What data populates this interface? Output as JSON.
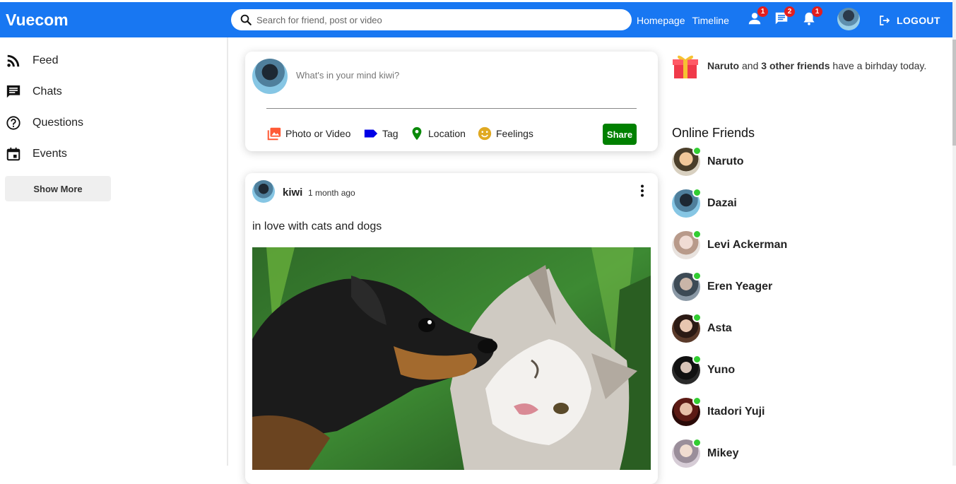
{
  "app": {
    "title": "Vuecom"
  },
  "header": {
    "search_placeholder": "Search for friend, post or video",
    "links": [
      "Homepage",
      "Timeline"
    ],
    "friend_requests_count": "1",
    "messages_count": "2",
    "notifications_count": "1",
    "logout_label": "LOGOUT"
  },
  "sidebar": {
    "items": [
      {
        "label": "Feed",
        "icon": "rss-icon"
      },
      {
        "label": "Chats",
        "icon": "chat-icon"
      },
      {
        "label": "Questions",
        "icon": "question-icon"
      },
      {
        "label": "Events",
        "icon": "calendar-icon"
      }
    ],
    "show_more": "Show More"
  },
  "share": {
    "placeholder": "What's in your mind kiwi?",
    "options": [
      "Photo or Video",
      "Tag",
      "Location",
      "Feelings"
    ],
    "share_button": "Share"
  },
  "post": {
    "username": "kiwi",
    "time": "1 month ago",
    "text": "in love with cats and dogs"
  },
  "birthday": {
    "name": "Naruto",
    "connector": "and",
    "others": "3 other friends",
    "suffix": "have a birhday today."
  },
  "online": {
    "title": "Online Friends",
    "friends": [
      "Naruto",
      "Dazai",
      "Levi Ackerman",
      "Eren Yeager",
      "Asta",
      "Yuno",
      "Itadori Yuji",
      "Mikey"
    ]
  },
  "colors": {
    "brand": "#1877f2",
    "share": "#008000",
    "online": "#32cd32",
    "badge": "#e41e1e"
  }
}
